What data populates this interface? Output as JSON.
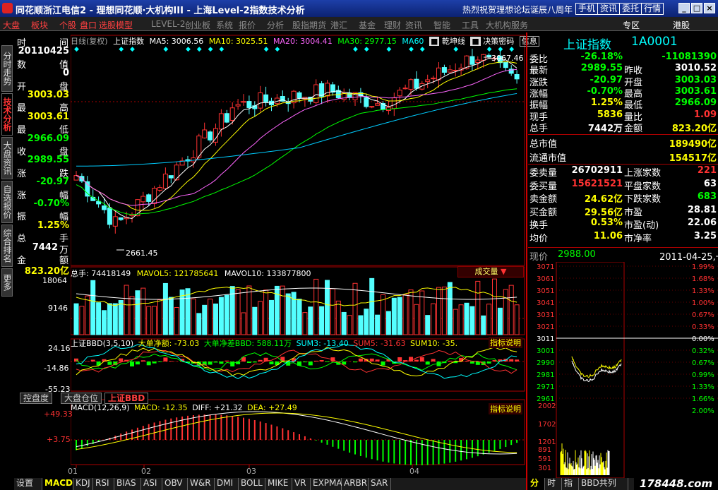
{
  "title_bar": {
    "title": "同花顺浙江电信2 - 理想同花顺·大机构III - 上海Level-2指数技术分析",
    "promo": "热烈祝贺理想论坛诞辰八周年",
    "buttons": [
      "手机",
      "资讯",
      "委托",
      "行情"
    ]
  },
  "menu": [
    {
      "label": "大盘",
      "c": "r"
    },
    {
      "label": "板块",
      "c": "r"
    },
    {
      "label": "个股",
      "c": "r"
    },
    {
      "label": "盘口",
      "c": "r"
    },
    {
      "label": "选股模型",
      "c": "r"
    },
    {
      "label": "LEVEL-2",
      "c": "g"
    },
    {
      "label": "创业板",
      "c": "g"
    },
    {
      "label": "系统",
      "c": "g"
    },
    {
      "label": "报价",
      "c": "g"
    },
    {
      "label": "分析",
      "c": "g"
    },
    {
      "label": "股指期货",
      "c": "g"
    },
    {
      "label": "港汇",
      "c": "g"
    },
    {
      "label": "基金",
      "c": "g"
    },
    {
      "label": "理财",
      "c": "g"
    },
    {
      "label": "资讯",
      "c": "g"
    },
    {
      "label": "智能",
      "c": "g"
    },
    {
      "label": "工具",
      "c": "g"
    },
    {
      "label": "大机构服务",
      "c": "g"
    },
    {
      "label": "专区",
      "c": "w"
    },
    {
      "label": "港股",
      "c": "w"
    }
  ],
  "left_nav": [
    {
      "label": "分时走势"
    },
    {
      "label": "技术分析",
      "active": true
    },
    {
      "label": "大盘资讯"
    },
    {
      "label": "自选报价"
    },
    {
      "label": "综合排名"
    },
    {
      "label": "更多"
    }
  ],
  "info_col": {
    "rows": [
      {
        "l": "时",
        "r": "间"
      },
      {
        "v": "20110425",
        "c": "wht"
      },
      {
        "l": "数",
        "r": "值"
      },
      {
        "v": "0",
        "c": "wht"
      },
      {
        "l": "开",
        "r": "盘"
      },
      {
        "v": "3003.03",
        "c": "ylw"
      },
      {
        "l": "最",
        "r": "高"
      },
      {
        "v": "3003.61",
        "c": "ylw"
      },
      {
        "l": "最",
        "r": "低"
      },
      {
        "v": "2966.09",
        "c": "grn"
      },
      {
        "l": "收",
        "r": "盘"
      },
      {
        "v": "2989.55",
        "c": "grn"
      },
      {
        "l": "涨",
        "r": "跌"
      },
      {
        "v": "-20.97",
        "c": "grn"
      },
      {
        "l": "涨",
        "r": "幅"
      },
      {
        "v": "-0.70%",
        "c": "grn"
      },
      {
        "l": "振",
        "r": "幅"
      },
      {
        "v": "1.25%",
        "c": "ylw"
      },
      {
        "l": "总",
        "r": "手"
      },
      {
        "v": "7442",
        "c": "wht",
        "suffix": "万"
      },
      {
        "l": "金",
        "r": "额"
      },
      {
        "v": "823.20亿",
        "c": "ylw"
      }
    ]
  },
  "kline_header": {
    "mode": "日线(复权)",
    "name": "上证指数",
    "ma5": "MA5: 3006.56",
    "ma10": "MA10: 3025.51",
    "ma20": "MA20: 3004.41",
    "ma30": "MA30: 2977.15",
    "ma60": "MA60",
    "qk": "乾坤线",
    "jc": "决策密码",
    "info": "信息"
  },
  "kline": {
    "high_label": "3067.46",
    "low_label": "2661.45"
  },
  "vol_header": {
    "total": "总手: 74418149",
    "mavol5": "MAVOL5: 121785641",
    "mavol10": "MAVOL10: 133877800",
    "dropdown": "成交量"
  },
  "vol_axis": [
    "18064",
    "9146"
  ],
  "bbd_header": {
    "name": "上证BBD(3,5,10)",
    "a": "大单净额: -73.03",
    "b": "大单净差BBD: 588.11万",
    "c": "SUM3: -13.40",
    "d": "SUM5: -31.63",
    "e": "SUM10: -35.",
    "btn": "指标说明"
  },
  "bbd_axis": [
    "24.16",
    "-14.86",
    "-55.23"
  ],
  "mid_tabs": [
    "控盘度",
    "大盘仓位",
    "上证BBD"
  ],
  "macd_header": {
    "name": "MACD(12,26,9)",
    "macd": "MACD: -12.35",
    "diff": "DIFF: +21.32",
    "dea": "DEA: +27.49",
    "btn": "指标说明"
  },
  "macd_axis": [
    "+49.33",
    "+3.75"
  ],
  "months": [
    "01",
    "02",
    "03",
    "04"
  ],
  "bottom_tabs": [
    "设置",
    "MACD",
    "KDJ",
    "RSI",
    "BIAS",
    "ASI",
    "OBV",
    "W&R",
    "DMI",
    "BOLL",
    "MIKE",
    "VR",
    "EXPMA",
    "ARBR",
    "SAR"
  ],
  "right": {
    "name": "上证指数",
    "code": "1A0001",
    "rows": [
      {
        "l1": "委比",
        "v1": "-26.18%",
        "c1": "grn",
        "l2": "",
        "v2": "-11081390",
        "c2": "grn"
      },
      {
        "l1": "最新",
        "v1": "2989.55",
        "c1": "grn",
        "l2": "昨收",
        "v2": "3010.52",
        "c2": "wht"
      },
      {
        "l1": "涨跌",
        "v1": "-20.97",
        "c1": "grn",
        "l2": "开盘",
        "v2": "3003.03",
        "c2": "grn"
      },
      {
        "l1": "涨幅",
        "v1": "-0.70%",
        "c1": "grn",
        "l2": "最高",
        "v2": "3003.61",
        "c2": "grn"
      },
      {
        "l1": "振幅",
        "v1": "1.25%",
        "c1": "ylw",
        "l2": "最低",
        "v2": "2966.09",
        "c2": "grn"
      },
      {
        "l1": "现手",
        "v1": "5836",
        "c1": "ylw",
        "l2": "量比",
        "v2": "1.09",
        "c2": "red"
      },
      {
        "l1": "总手",
        "v1": "7442万",
        "c1": "wht",
        "l2": "金额",
        "v2": "823.20亿",
        "c2": "ylw"
      }
    ],
    "rows2": [
      {
        "l": "总市值",
        "v": "189490亿",
        "c": "ylw"
      },
      {
        "l": "流通市值",
        "v": "154517亿",
        "c": "ylw"
      }
    ],
    "rows3": [
      {
        "l1": "委卖量",
        "v1": "26702911",
        "c1": "wht",
        "l2": "上涨家数",
        "v2": "221",
        "c2": "red"
      },
      {
        "l1": "委买量",
        "v1": "15621521",
        "c1": "red",
        "l2": "平盘家数",
        "v2": "63",
        "c2": "wht"
      },
      {
        "l1": "卖金额",
        "v1": "24.62亿",
        "c1": "ylw",
        "l2": "下跌家数",
        "v2": "683",
        "c2": "grn"
      },
      {
        "l1": "买金额",
        "v1": "29.56亿",
        "c1": "ylw",
        "l2": "市盈",
        "v2": "28.81",
        "c2": "wht"
      },
      {
        "l1": "换手",
        "v1": "0.53%",
        "c1": "ylw",
        "l2": "市盈(动)",
        "v2": "22.06",
        "c2": "wht"
      },
      {
        "l1": "均价",
        "v1": "11.06",
        "c1": "ylw",
        "l2": "市净率",
        "v2": "3.25",
        "c2": "wht"
      }
    ],
    "now_label": "现价",
    "now_val": "2988.00",
    "date": "2011-04-25,一",
    "price_axis": [
      "3071",
      "3061",
      "3051",
      "3041",
      "3031",
      "3021",
      "3011",
      "3001",
      "2990",
      "2981",
      "2971",
      "2961"
    ],
    "pct_axis": [
      "",
      "1.99%",
      "1.68%",
      "1.33%",
      "1.00%",
      "0.67%",
      "0.33%",
      "0.00%",
      "0.32%",
      "0.67%",
      "0.99%",
      "1.33%",
      "1.66%",
      "2.00%"
    ],
    "vol_axis": [
      "2002",
      "1702",
      "1201",
      "891",
      "591",
      "301"
    ],
    "bottom_tabs": [
      "分",
      "时",
      "指",
      "BBD共列"
    ],
    "watermark": "178448.com"
  }
}
